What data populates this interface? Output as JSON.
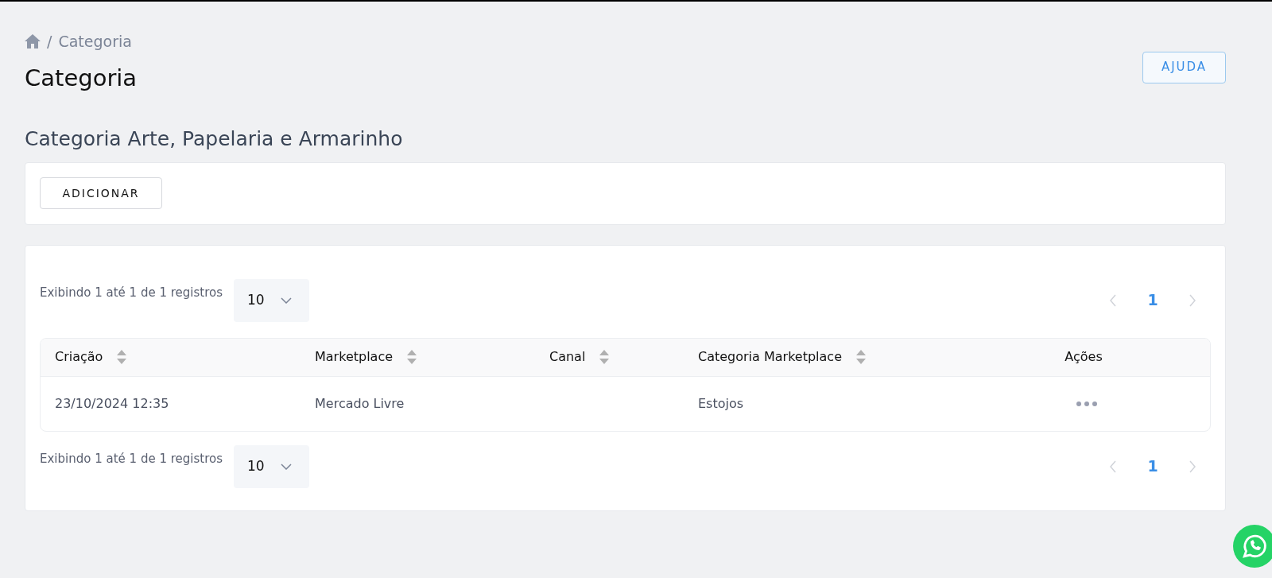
{
  "breadcrumb": {
    "separator": "/",
    "items": [
      "Categoria"
    ]
  },
  "page_title": "Categoria",
  "help_button": "AJUDA",
  "section_title": "Categoria Arte, Papelaria e Armarinho",
  "add_button": "ADICIONAR",
  "pagers": [
    {
      "summary": "Exibindo 1 até 1 de 1 registros",
      "page_size": "10",
      "prev_disabled": true,
      "next_disabled": true,
      "pages": [
        {
          "label": "1",
          "selected": true
        }
      ]
    },
    {
      "summary": "Exibindo 1 até 1 de 1 registros",
      "page_size": "10",
      "prev_disabled": true,
      "next_disabled": true,
      "pages": [
        {
          "label": "1",
          "selected": true
        }
      ]
    }
  ],
  "table": {
    "columns": [
      {
        "label": "Criação",
        "sortable": true
      },
      {
        "label": "Marketplace",
        "sortable": true
      },
      {
        "label": "Canal",
        "sortable": true
      },
      {
        "label": "Categoria Marketplace",
        "sortable": true
      },
      {
        "label": "Ações",
        "sortable": false
      }
    ],
    "rows": [
      {
        "cells": [
          "23/10/2024 12:35",
          "Mercado Livre",
          "",
          "Estojos"
        ]
      }
    ]
  }
}
